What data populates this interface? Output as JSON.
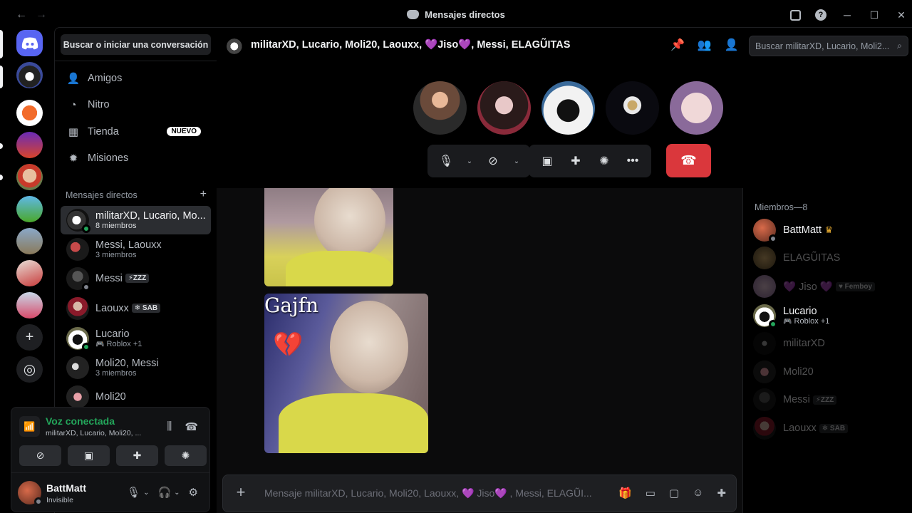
{
  "window": {
    "title": "Mensajes directos",
    "nav_back": "←",
    "nav_forward": "→",
    "minimize": "─",
    "maximize": "☐",
    "close": "✕"
  },
  "sidebar": {
    "search_label": "Buscar o iniciar una conversación",
    "nav": [
      {
        "label": "Amigos",
        "icon": "friends-icon"
      },
      {
        "label": "Nitro",
        "icon": "nitro-icon"
      },
      {
        "label": "Tienda",
        "icon": "shop-icon",
        "badge": "NUEVO"
      },
      {
        "label": "Misiones",
        "icon": "quests-icon"
      }
    ],
    "section_title": "Mensajes directos",
    "section_add": "+",
    "dms": [
      {
        "name": "militarXD, Lucario, Mo...",
        "sub": "8 miembros",
        "active": true
      },
      {
        "name": "Messi, Laouxx",
        "sub": "3 miembros"
      },
      {
        "name": "Messi",
        "tag": "⚡ZZZ"
      },
      {
        "name": "Laouxx",
        "tag": "❄ SAB"
      },
      {
        "name": "Lucario",
        "sub": "Roblox +1"
      },
      {
        "name": "Moli20, Messi",
        "sub": "3 miembros"
      },
      {
        "name": "Moli20"
      }
    ]
  },
  "voice": {
    "status": "Voz conectada",
    "channel": "militarXD, Lucario, Moli20, ..."
  },
  "user": {
    "name": "BattMatt",
    "status": "Invisible"
  },
  "header": {
    "title_a": "militarXD, Lucario, Moli20, Laouxx, ",
    "heart1": "💜",
    "title_b": "Jiso",
    "heart2": "💜",
    "title_c": ", Messi, ELAGŨITAS",
    "search_placeholder": "Buscar militarXD, Lucario, Moli2...",
    "search_icon": "⌕"
  },
  "messages": {
    "gif_caption": "Gajfn",
    "gif_emoji": "💔"
  },
  "composer": {
    "placeholder": "Mensaje militarXD, Lucario, Moli20, Laouxx, 💜 Jiso💜 , Messi, ELAGŨI..."
  },
  "members": {
    "header": "Miembros—8",
    "list": [
      {
        "name": "BattMatt",
        "crown": "♛",
        "online": true
      },
      {
        "name": "ELAGŨITAS",
        "offline": true
      },
      {
        "name": "💜 Jiso 💜",
        "tag": "♥ Femboy",
        "offline": true
      },
      {
        "name": "Lucario",
        "sub": "Roblox +1",
        "online": true
      },
      {
        "name": "militarXD",
        "offline": true
      },
      {
        "name": "Moli20",
        "offline": true
      },
      {
        "name": "Messi",
        "tag": "⚡ZZZ",
        "offline": true
      },
      {
        "name": "Laouxx",
        "tag": "❄ SAB",
        "offline": true
      }
    ]
  },
  "colors": {
    "accent": "#5865f2",
    "online": "#23a55a",
    "danger": "#da373c",
    "heart": "#a66cff"
  }
}
